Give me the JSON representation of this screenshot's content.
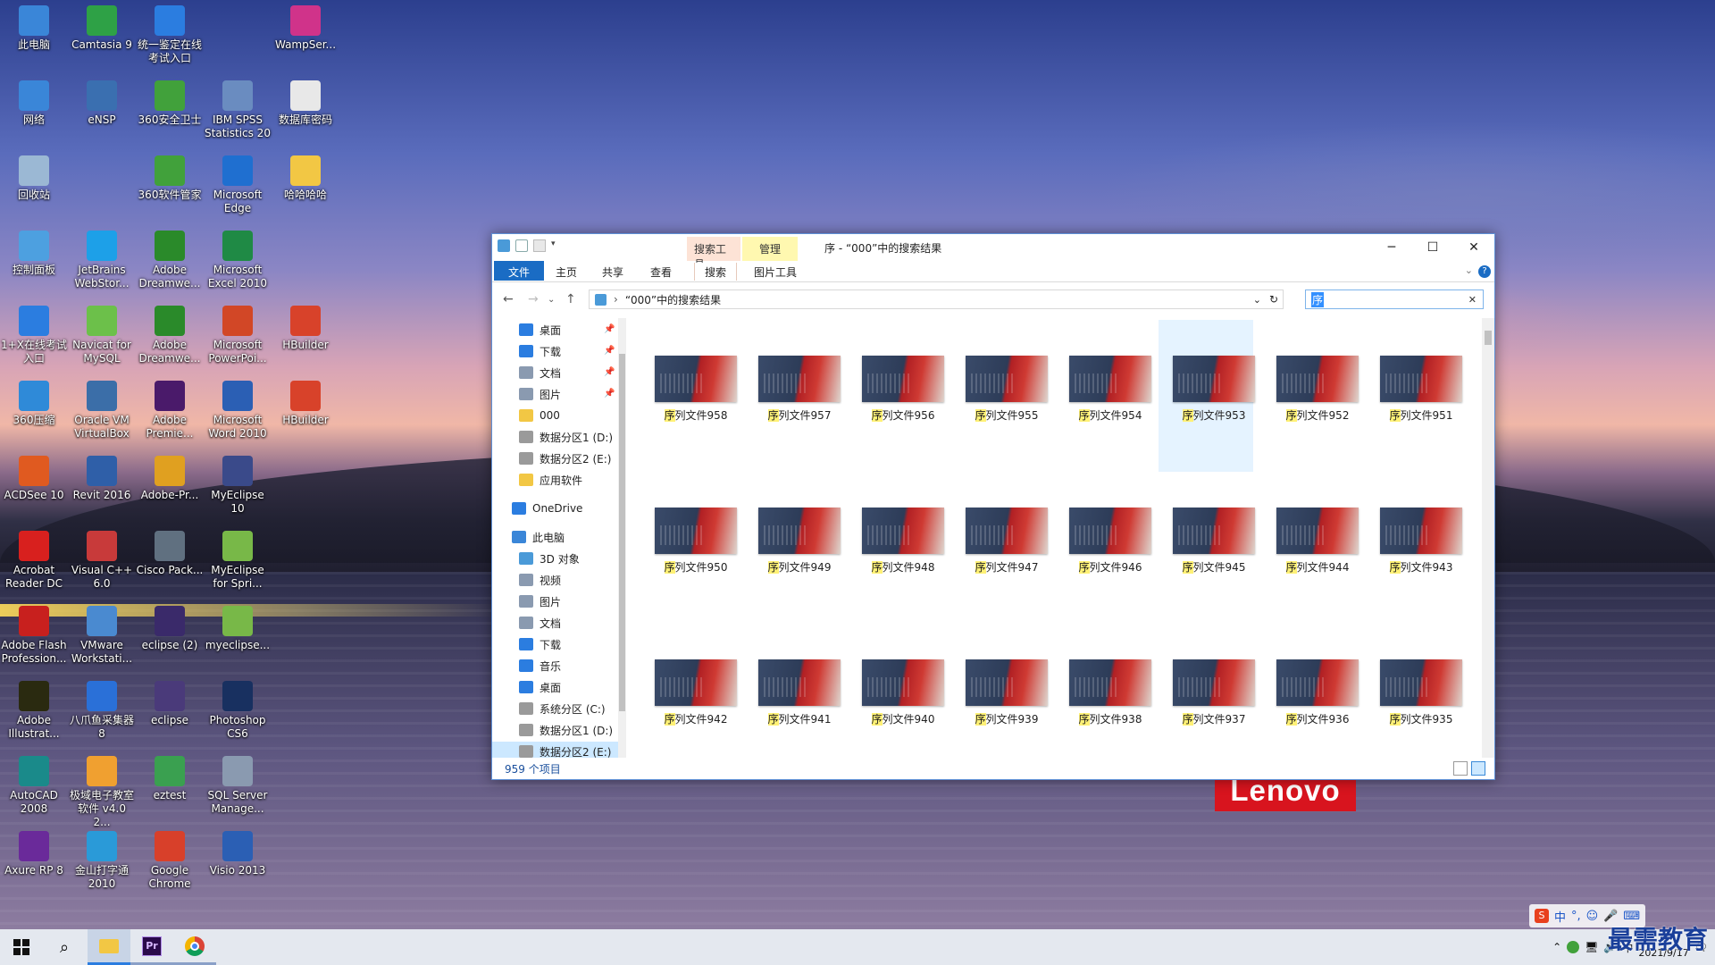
{
  "desktop_icons": [
    {
      "label": "此电脑",
      "color": "#3a86d8",
      "col": 0,
      "row": 0
    },
    {
      "label": "Camtasia 9",
      "color": "#2ea146",
      "col": 1,
      "row": 0
    },
    {
      "label": "统一鉴定在线考试入口",
      "color": "#2b7de0",
      "col": 2,
      "row": 0
    },
    {
      "label": "WampSer...",
      "color": "#d0338a",
      "col": 4,
      "row": 0
    },
    {
      "label": "网络",
      "color": "#3a86d8",
      "col": 0,
      "row": 1
    },
    {
      "label": "eNSP",
      "color": "#3a6fb0",
      "col": 1,
      "row": 1
    },
    {
      "label": "360安全卫士",
      "color": "#41a13b",
      "col": 2,
      "row": 1
    },
    {
      "label": "IBM SPSS Statistics 20",
      "color": "#6a8cc0",
      "col": 3,
      "row": 1
    },
    {
      "label": "数据库密码",
      "color": "#e8e8e8",
      "col": 4,
      "row": 1
    },
    {
      "label": "回收站",
      "color": "#9bb8d4",
      "col": 0,
      "row": 2
    },
    {
      "label": "360软件管家",
      "color": "#41a13b",
      "col": 2,
      "row": 2
    },
    {
      "label": "Microsoft Edge",
      "color": "#1f6fd0",
      "col": 3,
      "row": 2
    },
    {
      "label": "哈哈哈哈",
      "color": "#f2c744",
      "col": 4,
      "row": 2
    },
    {
      "label": "控制面板",
      "color": "#4da0e0",
      "col": 0,
      "row": 3
    },
    {
      "label": "JetBrains WebStor...",
      "color": "#1da0e8",
      "col": 1,
      "row": 3
    },
    {
      "label": "Adobe Dreamwe...",
      "color": "#2a8a2a",
      "col": 2,
      "row": 3
    },
    {
      "label": "Microsoft Excel 2010",
      "color": "#1f8a45",
      "col": 3,
      "row": 3
    },
    {
      "label": "1+X在线考试入口",
      "color": "#2b7de0",
      "col": 0,
      "row": 4
    },
    {
      "label": "Navicat for MySQL",
      "color": "#6cc04a",
      "col": 1,
      "row": 4
    },
    {
      "label": "Adobe Dreamwe...",
      "color": "#2a8a2a",
      "col": 2,
      "row": 4
    },
    {
      "label": "Microsoft PowerPoi...",
      "color": "#d24726",
      "col": 3,
      "row": 4
    },
    {
      "label": "HBuilder",
      "color": "#d8422a",
      "col": 4,
      "row": 4
    },
    {
      "label": "360压缩",
      "color": "#2f8ad8",
      "col": 0,
      "row": 5
    },
    {
      "label": "Oracle VM VirtualBox",
      "color": "#3b6ea8",
      "col": 1,
      "row": 5
    },
    {
      "label": "Adobe Premie...",
      "color": "#4a1a6a",
      "col": 2,
      "row": 5
    },
    {
      "label": "Microsoft Word 2010",
      "color": "#2b5fb4",
      "col": 3,
      "row": 5
    },
    {
      "label": "HBuilder",
      "color": "#d8422a",
      "col": 4,
      "row": 5
    },
    {
      "label": "ACDSee 10",
      "color": "#e05a20",
      "col": 0,
      "row": 6
    },
    {
      "label": "Revit 2016",
      "color": "#2f5fa8",
      "col": 1,
      "row": 6
    },
    {
      "label": "Adobe-Pr...",
      "color": "#e0a020",
      "col": 2,
      "row": 6
    },
    {
      "label": "MyEclipse 10",
      "color": "#3a4a8a",
      "col": 3,
      "row": 6
    },
    {
      "label": "Acrobat Reader DC",
      "color": "#d8201e",
      "col": 0,
      "row": 7
    },
    {
      "label": "Visual C++ 6.0",
      "color": "#c83a3a",
      "col": 1,
      "row": 7
    },
    {
      "label": "Cisco Pack...",
      "color": "#607080",
      "col": 2,
      "row": 7
    },
    {
      "label": "MyEclipse for Spri...",
      "color": "#78b848",
      "col": 3,
      "row": 7
    },
    {
      "label": "Adobe Flash Profession...",
      "color": "#c8201e",
      "col": 0,
      "row": 8
    },
    {
      "label": "VMware Workstati...",
      "color": "#4a8ad0",
      "col": 1,
      "row": 8
    },
    {
      "label": "eclipse (2)",
      "color": "#3a2a6a",
      "col": 2,
      "row": 8
    },
    {
      "label": "myeclipse...",
      "color": "#78b848",
      "col": 3,
      "row": 8
    },
    {
      "label": "Adobe Illustrat...",
      "color": "#2a2a10",
      "col": 0,
      "row": 9
    },
    {
      "label": "八爪鱼采集器 8",
      "color": "#2a70d8",
      "col": 1,
      "row": 9
    },
    {
      "label": "eclipse",
      "color": "#4a3a7a",
      "col": 2,
      "row": 9
    },
    {
      "label": "Photoshop CS6",
      "color": "#183060",
      "col": 3,
      "row": 9
    },
    {
      "label": "AutoCAD 2008",
      "color": "#1a8a8a",
      "col": 0,
      "row": 10
    },
    {
      "label": "极域电子教室软件 v4.0 2...",
      "color": "#f0a030",
      "col": 1,
      "row": 10
    },
    {
      "label": "eztest",
      "color": "#3aa050",
      "col": 2,
      "row": 10
    },
    {
      "label": "SQL Server Manage...",
      "color": "#8a9ab0",
      "col": 3,
      "row": 10
    },
    {
      "label": "Axure RP 8",
      "color": "#6a2a9a",
      "col": 0,
      "row": 11
    },
    {
      "label": "金山打字通 2010",
      "color": "#2a9ad8",
      "col": 1,
      "row": 11
    },
    {
      "label": "Google Chrome",
      "color": "#d8402a",
      "col": 2,
      "row": 11
    },
    {
      "label": "Visio 2013",
      "color": "#2b5fb4",
      "col": 3,
      "row": 11
    }
  ],
  "explorer": {
    "window_title": "序 - “000”中的搜索结果",
    "context_tabs": {
      "search_tools": "搜索工具",
      "manage": "管理"
    },
    "ribbon_tabs": {
      "file": "文件",
      "home": "主页",
      "share": "共享",
      "view": "查看",
      "search": "搜索",
      "picture_tools": "图片工具"
    },
    "address": "“000”中的搜索结果",
    "search_value": "序",
    "nav_items": [
      {
        "label": "桌面",
        "icon": "desktop-icon",
        "color": "#2b7de0",
        "pinned": true
      },
      {
        "label": "下载",
        "icon": "download-icon",
        "color": "#2b7de0",
        "pinned": true
      },
      {
        "label": "文档",
        "icon": "documents-icon",
        "color": "#8a9ab0",
        "pinned": true
      },
      {
        "label": "图片",
        "icon": "pictures-icon",
        "color": "#8a9ab0",
        "pinned": true
      },
      {
        "label": "000",
        "icon": "folder-icon",
        "color": "#f2c744",
        "pinned": false
      },
      {
        "label": "数据分区1 (D:)",
        "icon": "drive-icon",
        "color": "#9a9a9a",
        "pinned": false
      },
      {
        "label": "数据分区2 (E:)",
        "icon": "drive-icon",
        "color": "#9a9a9a",
        "pinned": false
      },
      {
        "label": "应用软件",
        "icon": "folder-icon",
        "color": "#f2c744",
        "pinned": false
      },
      {
        "label": "OneDrive",
        "icon": "cloud-icon",
        "color": "#2b7de0",
        "pinned": false,
        "group": true
      },
      {
        "label": "此电脑",
        "icon": "computer-icon",
        "color": "#3a86d8",
        "pinned": false,
        "group": true
      },
      {
        "label": "3D 对象",
        "icon": "3d-icon",
        "color": "#4a9ad8",
        "pinned": false
      },
      {
        "label": "视频",
        "icon": "video-icon",
        "color": "#8a9ab0",
        "pinned": false
      },
      {
        "label": "图片",
        "icon": "pictures-icon",
        "color": "#8a9ab0",
        "pinned": false
      },
      {
        "label": "文档",
        "icon": "documents-icon",
        "color": "#8a9ab0",
        "pinned": false
      },
      {
        "label": "下载",
        "icon": "download-icon",
        "color": "#2b7de0",
        "pinned": false
      },
      {
        "label": "音乐",
        "icon": "music-icon",
        "color": "#2b7de0",
        "pinned": false
      },
      {
        "label": "桌面",
        "icon": "desktop-icon",
        "color": "#2b7de0",
        "pinned": false
      },
      {
        "label": "系统分区 (C:)",
        "icon": "drive-icon",
        "color": "#9a9a9a",
        "pinned": false
      },
      {
        "label": "数据分区1 (D:)",
        "icon": "drive-icon",
        "color": "#9a9a9a",
        "pinned": false
      },
      {
        "label": "数据分区2 (E:)",
        "icon": "drive-icon",
        "color": "#9a9a9a",
        "pinned": false,
        "selected": true
      }
    ],
    "files": [
      {
        "hl": "序",
        "rest": "列文件958"
      },
      {
        "hl": "序",
        "rest": "列文件957"
      },
      {
        "hl": "序",
        "rest": "列文件956"
      },
      {
        "hl": "序",
        "rest": "列文件955"
      },
      {
        "hl": "序",
        "rest": "列文件954"
      },
      {
        "hl": "序",
        "rest": "列文件953",
        "selected": true
      },
      {
        "hl": "序",
        "rest": "列文件952"
      },
      {
        "hl": "序",
        "rest": "列文件951"
      },
      {
        "hl": "序",
        "rest": "列文件950"
      },
      {
        "hl": "序",
        "rest": "列文件949"
      },
      {
        "hl": "序",
        "rest": "列文件948"
      },
      {
        "hl": "序",
        "rest": "列文件947"
      },
      {
        "hl": "序",
        "rest": "列文件946"
      },
      {
        "hl": "序",
        "rest": "列文件945"
      },
      {
        "hl": "序",
        "rest": "列文件944"
      },
      {
        "hl": "序",
        "rest": "列文件943"
      },
      {
        "hl": "序",
        "rest": "列文件942"
      },
      {
        "hl": "序",
        "rest": "列文件941"
      },
      {
        "hl": "序",
        "rest": "列文件940"
      },
      {
        "hl": "序",
        "rest": "列文件939"
      },
      {
        "hl": "序",
        "rest": "列文件938"
      },
      {
        "hl": "序",
        "rest": "列文件937"
      },
      {
        "hl": "序",
        "rest": "列文件936"
      },
      {
        "hl": "序",
        "rest": "列文件935"
      }
    ],
    "status": "959 个项目",
    "colors": {
      "accent": "#1a6cc4",
      "search_tools_bg": "#fde3d6",
      "manage_bg": "#fff8b0"
    }
  },
  "taskbar": {
    "clock_date": "2021/9/17",
    "watermark": "最需教育",
    "ime_label": "中"
  }
}
